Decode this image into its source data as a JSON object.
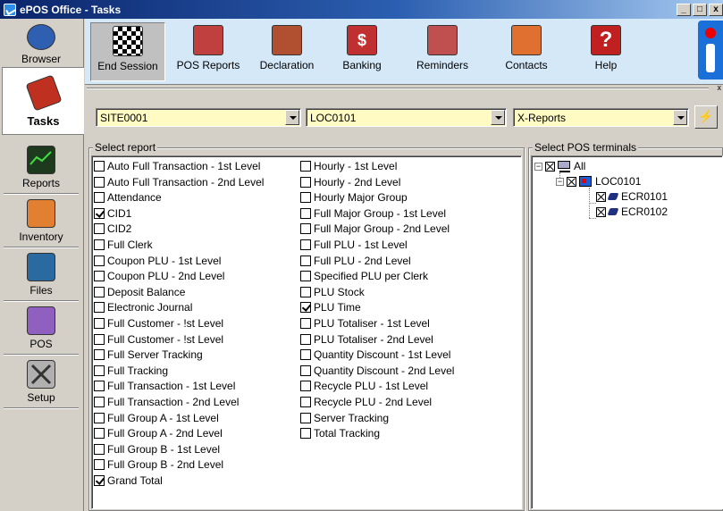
{
  "window": {
    "title": "ePOS Office - Tasks",
    "buttons": [
      "_",
      "□",
      "x"
    ]
  },
  "nav": {
    "items": [
      {
        "label": "Browser",
        "icon": "globe-icon",
        "color": "#2f5fb0"
      },
      {
        "label": "Tasks",
        "icon": "tasks-icon",
        "color": "#c03020",
        "active": true
      },
      {
        "label": "Reports",
        "icon": "chart-icon",
        "color": "#2a7a2a"
      },
      {
        "label": "Inventory",
        "icon": "inventory-icon",
        "color": "#e08030"
      },
      {
        "label": "Files",
        "icon": "files-icon",
        "color": "#2a6aa0"
      },
      {
        "label": "POS",
        "icon": "pos-icon",
        "color": "#9060c0"
      },
      {
        "label": "Setup",
        "icon": "setup-icon",
        "color": "#909090"
      }
    ]
  },
  "toolbar": {
    "buttons": [
      {
        "label": "End Session",
        "icon": "checkered-flag-icon",
        "color": "#b03030",
        "pressed": true
      },
      {
        "label": "POS Reports",
        "icon": "pos-reports-icon",
        "color": "#c04040"
      },
      {
        "label": "Declaration",
        "icon": "declaration-icon",
        "color": "#b05030"
      },
      {
        "label": "Banking",
        "icon": "money-bag-icon",
        "color": "#c03030"
      },
      {
        "label": "Reminders",
        "icon": "bell-icon",
        "color": "#c05050"
      },
      {
        "label": "Contacts",
        "icon": "contacts-icon",
        "color": "#e07030"
      },
      {
        "label": "Help",
        "icon": "help-icon",
        "color": "#c02020"
      }
    ],
    "help_glyph": "?",
    "banking_glyph": "$"
  },
  "selectors": {
    "site": "SITE0001",
    "location": "LOC0101",
    "report_type": "X-Reports",
    "run_glyph": "⚡"
  },
  "reports": {
    "title": "Select report",
    "column1": [
      {
        "label": "Auto Full Transaction - 1st Level",
        "checked": false
      },
      {
        "label": "Auto Full Transaction - 2nd Level",
        "checked": false
      },
      {
        "label": "Attendance",
        "checked": false
      },
      {
        "label": "CID1",
        "checked": true
      },
      {
        "label": "CID2",
        "checked": false
      },
      {
        "label": "Full Clerk",
        "checked": false
      },
      {
        "label": "Coupon PLU - 1st Level",
        "checked": false
      },
      {
        "label": "Coupon PLU - 2nd Level",
        "checked": false
      },
      {
        "label": "Deposit Balance",
        "checked": false
      },
      {
        "label": "Electronic Journal",
        "checked": false
      },
      {
        "label": "Full Customer - !st Level",
        "checked": false
      },
      {
        "label": "Full Customer - !st Level",
        "checked": false
      },
      {
        "label": "Full Server Tracking",
        "checked": false
      },
      {
        "label": "Full Tracking",
        "checked": false
      },
      {
        "label": "Full Transaction - 1st Level",
        "checked": false
      },
      {
        "label": "Full Transaction - 2nd Level",
        "checked": false
      },
      {
        "label": "Full Group A - 1st Level",
        "checked": false
      },
      {
        "label": "Full Group A - 2nd Level",
        "checked": false
      },
      {
        "label": "Full Group B - 1st Level",
        "checked": false
      },
      {
        "label": "Full Group B - 2nd Level",
        "checked": false
      },
      {
        "label": "Grand Total",
        "checked": true
      }
    ],
    "column2": [
      {
        "label": "Hourly - 1st Level",
        "checked": false
      },
      {
        "label": "Hourly - 2nd Level",
        "checked": false
      },
      {
        "label": "Hourly Major Group",
        "checked": false
      },
      {
        "label": "Full Major Group - 1st Level",
        "checked": false
      },
      {
        "label": "Full Major Group - 2nd Level",
        "checked": false
      },
      {
        "label": "Full PLU - 1st Level",
        "checked": false
      },
      {
        "label": "Full PLU - 2nd Level",
        "checked": false
      },
      {
        "label": "Specified PLU per Clerk",
        "checked": false
      },
      {
        "label": "PLU Stock",
        "checked": false
      },
      {
        "label": "PLU Time",
        "checked": true
      },
      {
        "label": "PLU Totaliser - 1st Level",
        "checked": false
      },
      {
        "label": "PLU Totaliser - 2nd Level",
        "checked": false
      },
      {
        "label": "Quantity Discount - 1st Level",
        "checked": false
      },
      {
        "label": "Quantity Discount - 2nd Level",
        "checked": false
      },
      {
        "label": "Recycle PLU - 1st Level",
        "checked": false
      },
      {
        "label": "Recycle PLU - 2nd Level",
        "checked": false
      },
      {
        "label": "Server Tracking",
        "checked": false
      },
      {
        "label": "Total Tracking",
        "checked": false
      }
    ]
  },
  "terminals": {
    "title": "Select POS terminals",
    "root": "All",
    "location": "LOC0101",
    "items": [
      "ECR0101",
      "ECR0102"
    ]
  }
}
